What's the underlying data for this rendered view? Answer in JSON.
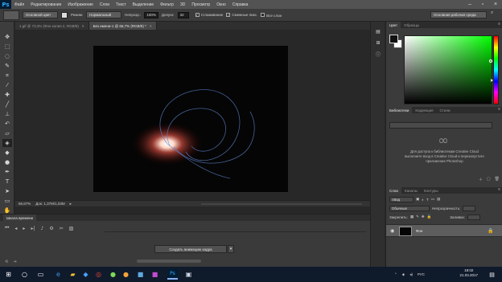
{
  "app": {
    "logo": "Ps",
    "menu": [
      "Файл",
      "Редактирование",
      "Изображение",
      "Слои",
      "Текст",
      "Выделение",
      "Фильтр",
      "3D",
      "Просмотр",
      "Окно",
      "Справка"
    ],
    "window_controls": [
      "minimize-icon",
      "maximize-icon",
      "close-icon"
    ]
  },
  "options": {
    "tool_select": "Основной цвет",
    "mode_label": "Режим:",
    "mode_value": "Нормальный",
    "opacity_label": "Непрозр.:",
    "opacity_value": "100%",
    "tolerance_label": "Допуск:",
    "tolerance_value": "32",
    "antialias_label": "Сглаживание",
    "contiguous_label": "Смежные пикс.",
    "all_layers_label": "Все слои",
    "workspace": "Основная рабочая среда"
  },
  "documents": {
    "tabs": [
      {
        "label": "1.gif @ 73,3% (Фон копия 2, RGB/8)",
        "close": "×"
      },
      {
        "label": "Без имени-1 @ 66,7% (RGB/8) *",
        "close": "×"
      }
    ],
    "zoom": "66,67%",
    "doc_info": "Док: 1,37М/1,03М"
  },
  "timeline": {
    "tab": "Шкала времени",
    "create_button": "Создать анимацию кадра",
    "dropdown_arrow": "▾"
  },
  "color_panel": {
    "tabs": [
      "Цвет",
      "Образцы"
    ],
    "fg_color": "#111111",
    "bg_color": "#ffffff",
    "hue_color": "#00ff00"
  },
  "libraries_panel": {
    "tabs": [
      "Библиотеки",
      "Коррекция",
      "Стили"
    ],
    "message": "Для доступа к библиотекам Creative Cloud выполните вход в Creative Cloud и перезапустите приложение Photoshop"
  },
  "layers_panel": {
    "tabs": [
      "Слои",
      "Каналы",
      "Контуры"
    ],
    "filter_label": "Вид",
    "blend_mode": "Обычные",
    "opacity_label": "Непрозрачность:",
    "lock_label": "Закрепить:",
    "fill_label": "Заливка:",
    "layer_name": "Фон"
  },
  "taskbar": {
    "language": "РУС",
    "time": "18:02",
    "date": "21.03.2017"
  }
}
